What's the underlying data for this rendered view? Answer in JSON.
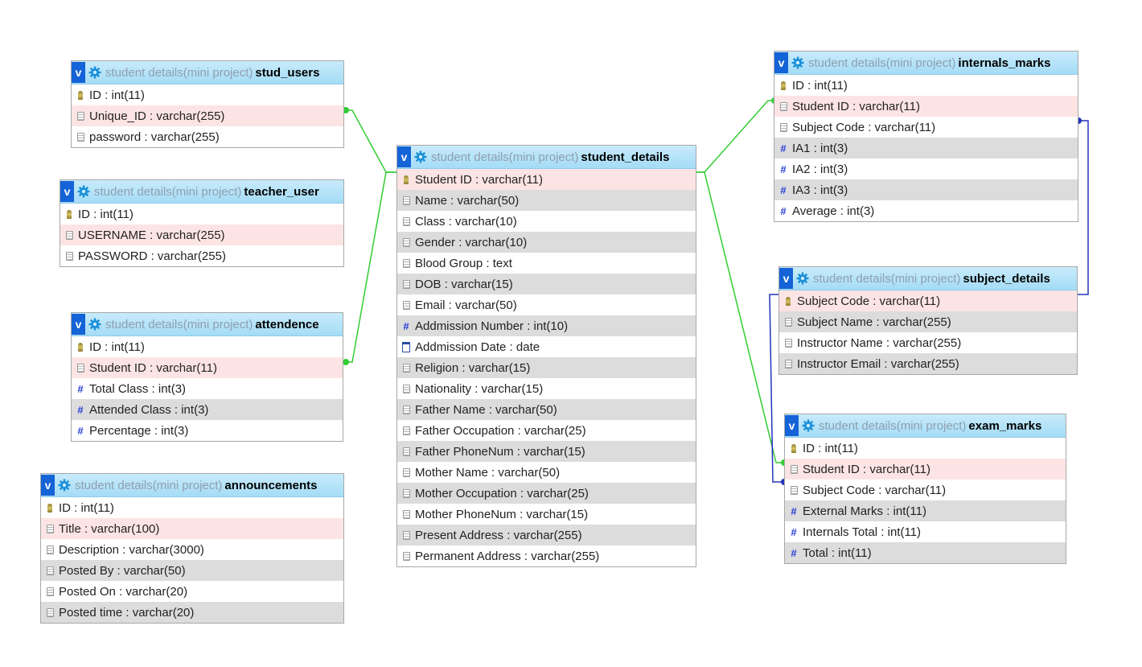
{
  "db_label": "student details(mini project)",
  "tables": {
    "stud_users": {
      "name": "stud_users",
      "columns": [
        {
          "text": "ID : int(11)",
          "icon": "key-icon"
        },
        {
          "text": "Unique_ID : varchar(255)",
          "icon": "text-field-icon"
        },
        {
          "text": "password : varchar(255)",
          "icon": "text-field-icon"
        }
      ]
    },
    "teacher_user": {
      "name": "teacher_user",
      "columns": [
        {
          "text": "ID : int(11)",
          "icon": "key-icon"
        },
        {
          "text": "USERNAME : varchar(255)",
          "icon": "text-field-icon"
        },
        {
          "text": "PASSWORD : varchar(255)",
          "icon": "text-field-icon"
        }
      ]
    },
    "attendence": {
      "name": "attendence",
      "columns": [
        {
          "text": "ID : int(11)",
          "icon": "key-icon"
        },
        {
          "text": "Student ID : varchar(11)",
          "icon": "text-field-icon"
        },
        {
          "text": "Total Class : int(3)",
          "icon": "numeric-field-icon"
        },
        {
          "text": "Attended Class : int(3)",
          "icon": "numeric-field-icon"
        },
        {
          "text": "Percentage : int(3)",
          "icon": "numeric-field-icon"
        }
      ]
    },
    "announcements": {
      "name": "announcements",
      "columns": [
        {
          "text": "ID : int(11)",
          "icon": "key-icon"
        },
        {
          "text": "Title : varchar(100)",
          "icon": "text-field-icon"
        },
        {
          "text": "Description : varchar(3000)",
          "icon": "text-field-icon"
        },
        {
          "text": "Posted By : varchar(50)",
          "icon": "text-field-icon"
        },
        {
          "text": "Posted On : varchar(20)",
          "icon": "text-field-icon"
        },
        {
          "text": "Posted time : varchar(20)",
          "icon": "text-field-icon"
        }
      ]
    },
    "student_details": {
      "name": "student_details",
      "columns": [
        {
          "text": "Student ID : varchar(11)",
          "icon": "key-icon"
        },
        {
          "text": "Name : varchar(50)",
          "icon": "text-field-icon"
        },
        {
          "text": "Class : varchar(10)",
          "icon": "text-field-icon"
        },
        {
          "text": "Gender : varchar(10)",
          "icon": "text-field-icon"
        },
        {
          "text": "Blood Group : text",
          "icon": "text-field-icon"
        },
        {
          "text": "DOB : varchar(15)",
          "icon": "text-field-icon"
        },
        {
          "text": "Email : varchar(50)",
          "icon": "text-field-icon"
        },
        {
          "text": "Addmission Number : int(10)",
          "icon": "numeric-field-icon"
        },
        {
          "text": "Addmission Date : date",
          "icon": "date-field-icon"
        },
        {
          "text": "Religion : varchar(15)",
          "icon": "text-field-icon"
        },
        {
          "text": "Nationality : varchar(15)",
          "icon": "text-field-icon"
        },
        {
          "text": "Father Name : varchar(50)",
          "icon": "text-field-icon"
        },
        {
          "text": "Father Occupation : varchar(25)",
          "icon": "text-field-icon"
        },
        {
          "text": "Father PhoneNum : varchar(15)",
          "icon": "text-field-icon"
        },
        {
          "text": "Mother Name : varchar(50)",
          "icon": "text-field-icon"
        },
        {
          "text": "Mother Occupation : varchar(25)",
          "icon": "text-field-icon"
        },
        {
          "text": "Mother PhoneNum : varchar(15)",
          "icon": "text-field-icon"
        },
        {
          "text": "Present Address : varchar(255)",
          "icon": "text-field-icon"
        },
        {
          "text": "Permanent Address : varchar(255)",
          "icon": "text-field-icon"
        }
      ]
    },
    "internals_marks": {
      "name": "internals_marks",
      "columns": [
        {
          "text": "ID : int(11)",
          "icon": "key-icon"
        },
        {
          "text": "Student ID : varchar(11)",
          "icon": "text-field-icon"
        },
        {
          "text": "Subject Code : varchar(11)",
          "icon": "text-field-icon"
        },
        {
          "text": "IA1 : int(3)",
          "icon": "numeric-field-icon"
        },
        {
          "text": "IA2 : int(3)",
          "icon": "numeric-field-icon"
        },
        {
          "text": "IA3 : int(3)",
          "icon": "numeric-field-icon"
        },
        {
          "text": "Average : int(3)",
          "icon": "numeric-field-icon"
        }
      ]
    },
    "subject_details": {
      "name": "subject_details",
      "columns": [
        {
          "text": "Subject Code : varchar(11)",
          "icon": "key-icon"
        },
        {
          "text": "Subject Name : varchar(255)",
          "icon": "text-field-icon"
        },
        {
          "text": "Instructor Name : varchar(255)",
          "icon": "text-field-icon"
        },
        {
          "text": "Instructor Email : varchar(255)",
          "icon": "text-field-icon"
        }
      ]
    },
    "exam_marks": {
      "name": "exam_marks",
      "columns": [
        {
          "text": "ID : int(11)",
          "icon": "key-icon"
        },
        {
          "text": "Student ID : varchar(11)",
          "icon": "text-field-icon"
        },
        {
          "text": "Subject Code : varchar(11)",
          "icon": "text-field-icon"
        },
        {
          "text": "External Marks : int(11)",
          "icon": "numeric-field-icon"
        },
        {
          "text": "Internals Total : int(11)",
          "icon": "numeric-field-icon"
        },
        {
          "text": "Total : int(11)",
          "icon": "numeric-field-icon"
        }
      ]
    }
  },
  "colors": {
    "student_link": "#33cc33",
    "subject_link": "#2233bb",
    "header": "#a4dcf6",
    "pk_row": "#fde4e4",
    "alt_row": "#dcdcdc"
  }
}
